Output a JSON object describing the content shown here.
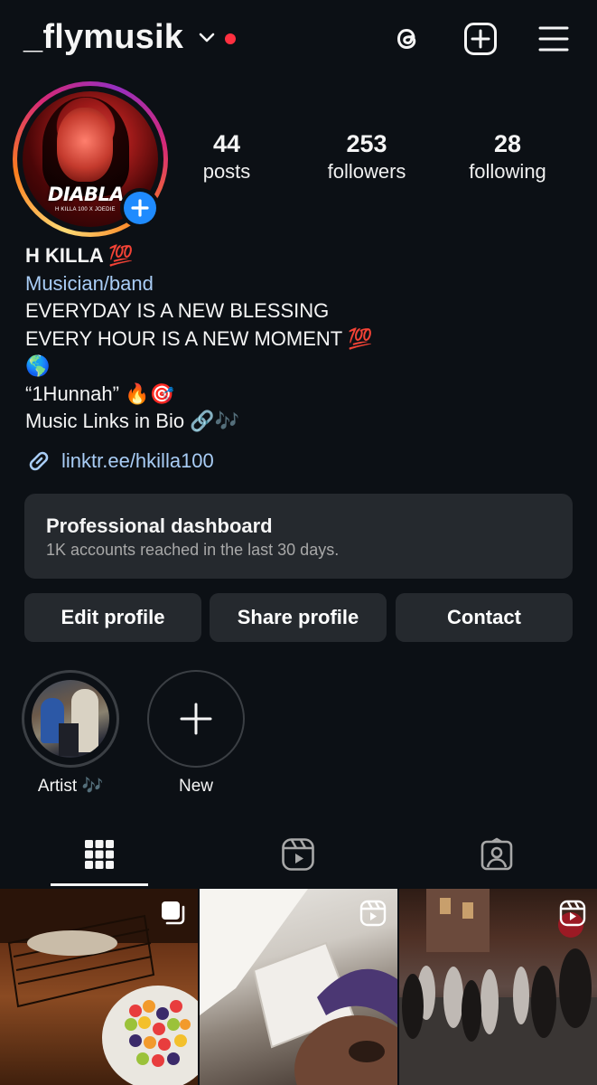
{
  "header": {
    "username": "_flymusik",
    "icons": [
      "threads-icon",
      "create-post-icon",
      "menu-icon"
    ]
  },
  "avatar": {
    "cover_title": "DIABLA",
    "cover_subtitle": "H KILLA 100 X JOEDIE"
  },
  "stats": [
    {
      "value": "44",
      "label": "posts"
    },
    {
      "value": "253",
      "label": "followers"
    },
    {
      "value": "28",
      "label": "following"
    }
  ],
  "bio": {
    "name": "H KILLA 💯",
    "category": "Musician/band",
    "lines": [
      "EVERYDAY IS A NEW BLESSING",
      "EVERY HOUR IS A NEW MOMENT 💯",
      "🌎",
      "“1Hunnah” 🔥🎯",
      "Music Links in Bio 🔗🎶"
    ],
    "link": "linktr.ee/hkilla100"
  },
  "dashboard": {
    "title": "Professional dashboard",
    "subtitle": "1K accounts reached in the last 30 days."
  },
  "buttons": {
    "edit": "Edit profile",
    "share": "Share profile",
    "contact": "Contact"
  },
  "highlights": [
    {
      "label": "Artist 🎶"
    },
    {
      "label": "New"
    }
  ],
  "tabs": [
    "grid-icon",
    "reels-icon",
    "tagged-icon"
  ],
  "colors": {
    "background": "#0c1015",
    "card": "#25292e",
    "link": "#a9cdf6",
    "accent_blue": "#1f8bfe",
    "notification_red": "#ff3040"
  }
}
